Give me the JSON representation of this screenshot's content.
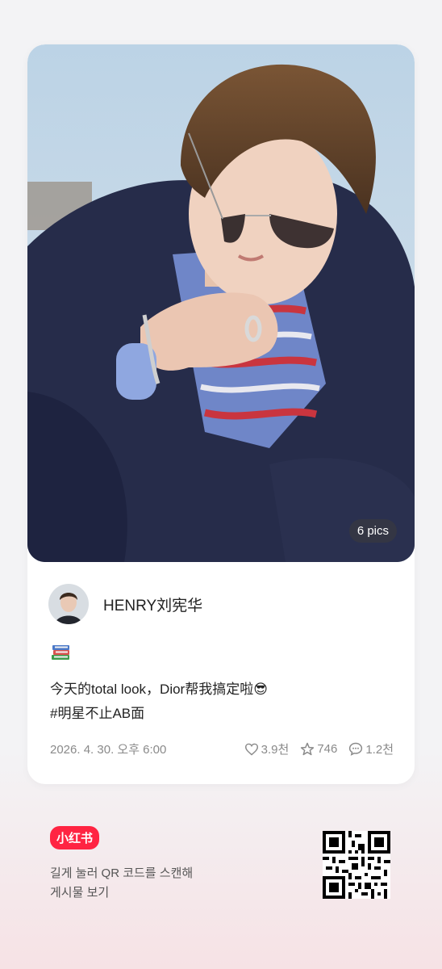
{
  "post": {
    "pic_count": "6 pics",
    "author_name": "HENRY刘宪华",
    "emoji": "📚",
    "text": "今天的total look，Dior帮我搞定啦😎",
    "hashtag": "#明星不止AB面",
    "date": "2026. 4. 30. 오후 6:00",
    "likes": "3.9천",
    "favorites": "746",
    "comments": "1.2천"
  },
  "footer": {
    "logo": "小红书",
    "instruction_line1": "길게 눌러 QR 코드를 스캔해",
    "instruction_line2": "게시물 보기"
  },
  "icons": {
    "heart": "heart-icon",
    "star": "star-icon",
    "comment": "comment-icon",
    "qr": "qr-code"
  },
  "colors": {
    "brand": "#ff2442",
    "text": "#222222",
    "muted": "#8a8a8a"
  }
}
